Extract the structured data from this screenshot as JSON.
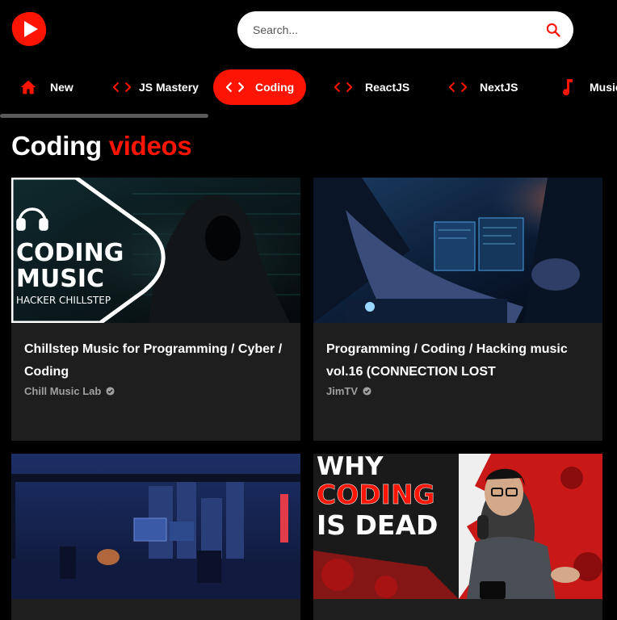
{
  "app": {
    "logo_icon": "youtube-play-logo-icon",
    "brand_color": "#FC1503"
  },
  "search": {
    "placeholder": "Search...",
    "value": "",
    "icon": "search-icon"
  },
  "categories": [
    {
      "label": "New",
      "icon": "home-icon",
      "active": false
    },
    {
      "label": "JS Mastery",
      "icon": "code-icon",
      "active": false
    },
    {
      "label": "Coding",
      "icon": "code-icon",
      "active": true
    },
    {
      "label": "ReactJS",
      "icon": "code-icon",
      "active": false
    },
    {
      "label": "NextJS",
      "icon": "code-icon",
      "active": false
    },
    {
      "label": "Music",
      "icon": "music-note-icon",
      "active": false
    }
  ],
  "feed": {
    "title_main": "Coding",
    "title_accent": "videos"
  },
  "videos": [
    {
      "thumb_text_line1": "CODING",
      "thumb_text_line2": "MUSIC",
      "thumb_text_line3": "HACKER CHILLSTEP",
      "title": "Chillstep Music for Programming / Cyber / Coding",
      "channel": "Chill Music Lab",
      "verified_icon": "check-circle-icon"
    },
    {
      "title": "Programming / Coding / Hacking music vol.16 (CONNECTION LOST",
      "channel": "JimTV",
      "verified_icon": "check-circle-icon"
    },
    {
      "title": "",
      "channel": ""
    },
    {
      "thumb_text_line1": "WHY",
      "thumb_text_line2": "CODING",
      "thumb_text_line3": "IS DEAD",
      "title": "",
      "channel": ""
    }
  ]
}
